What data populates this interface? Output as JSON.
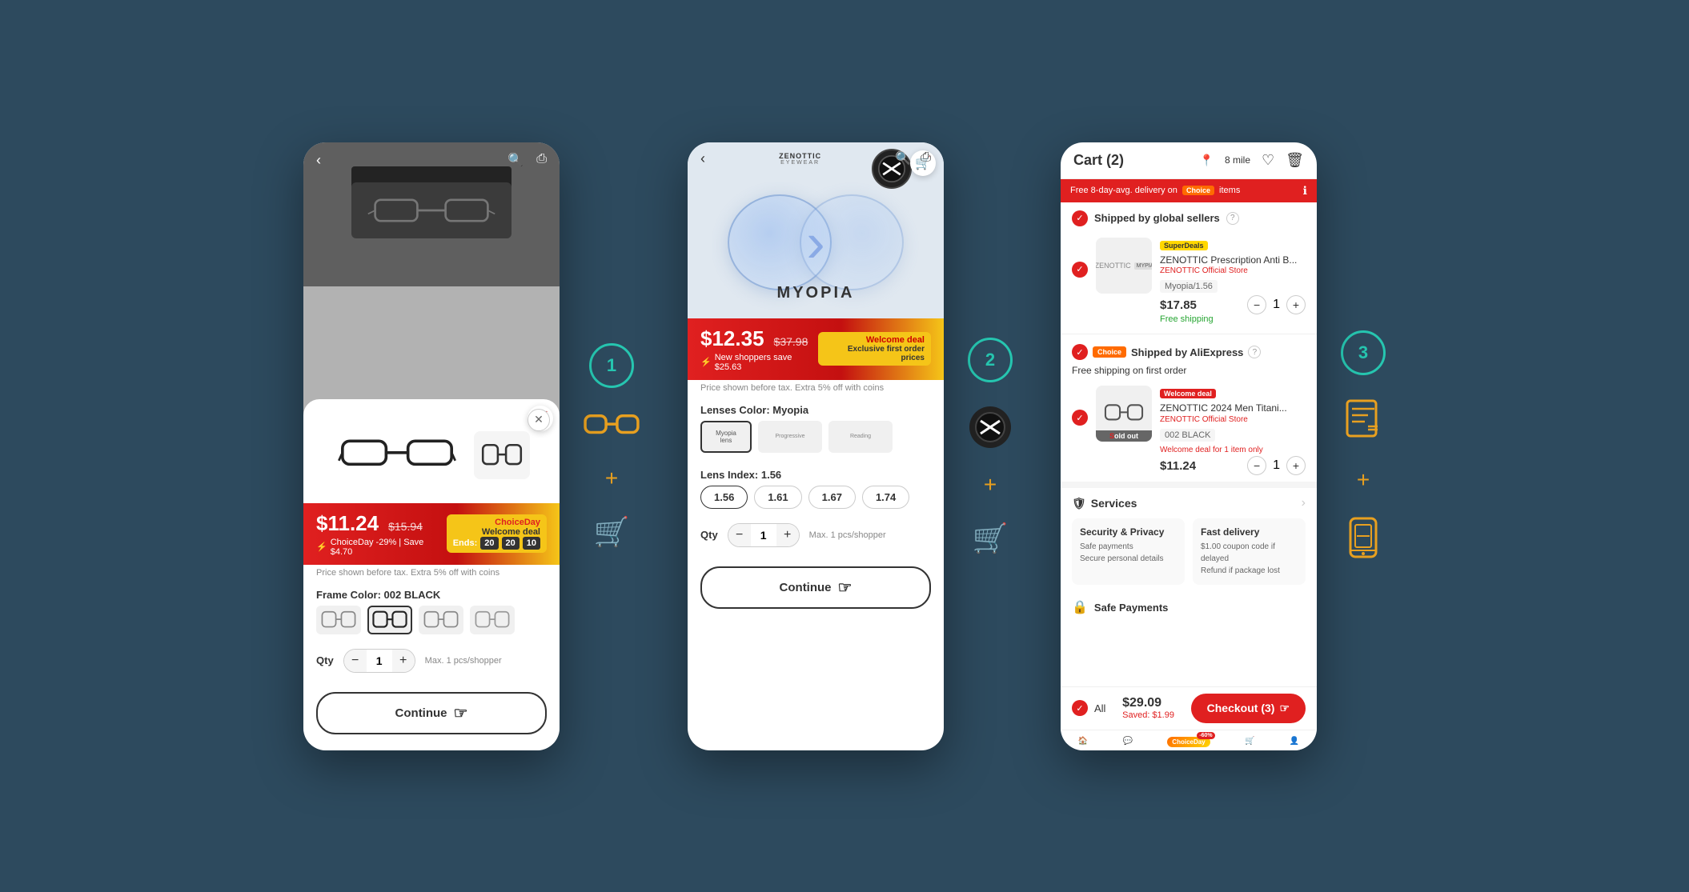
{
  "page": {
    "bg_color": "#2d4a5e"
  },
  "phone1": {
    "price_main": "$11.24",
    "price_orig": "$15.94",
    "badge_title": "ChoiceDay",
    "badge_sub": "Welcome deal",
    "discount_pct": "ChoiceDay -29% | Save $4.70",
    "ends_label": "Ends:",
    "countdown": [
      "20",
      "20",
      "10"
    ],
    "price_notice": "Price shown before tax. Extra 5% off with coins",
    "frame_color_label": "Frame Color: 002 BLACK",
    "qty_label": "Qty",
    "qty_value": "1",
    "max_note": "Max. 1 pcs/shopper",
    "continue_label": "Continue"
  },
  "phone2": {
    "brand": "ZENOTTIC",
    "brand_sub": "EYEWEAR",
    "lens_label": "MYOPIA",
    "price_main": "$12.35",
    "price_orig": "$37.98",
    "deal_label": "Welcome deal",
    "deal_sub": "Exclusive first order prices",
    "new_shopper_save": "New shoppers save $25.63",
    "price_notice": "Price shown before tax. Extra 5% off with coins",
    "lenses_color_label": "Lenses Color: Myopia",
    "lens_index_label": "Lens Index: 1.56",
    "index_options": [
      "1.56",
      "1.61",
      "1.67",
      "1.74"
    ],
    "qty_label": "Qty",
    "qty_value": "1",
    "max_note": "Max. 1 pcs/shopper",
    "continue_label": "Continue"
  },
  "phone3": {
    "cart_title": "Cart (2)",
    "location": "8 mile",
    "delivery_banner": "Free 8-day-avg. delivery on",
    "delivery_banner2": "items",
    "section1_title": "Shipped by global sellers",
    "item1_tag": "SuperDeals",
    "item1_name": "ZENOTTIC Prescription Anti B...",
    "item1_store": "ZENOTTIC Official Store",
    "item1_variant": "Myopia/1.56",
    "item1_price": "$17.85",
    "item1_qty": "1",
    "item1_shipping": "Free shipping",
    "section2_badge": "Choice",
    "section2_title": "Shipped by AliExpress",
    "free_ship_note": "Free shipping on first order",
    "item2_tag": "Welcome deal",
    "item2_name": "ZENOTTIC 2024 Men Titani...",
    "item2_store": "ZENOTTIC Official Store",
    "item2_variant": "002 BLACK",
    "item2_sold_out": "old out",
    "item2_welcome": "Welcome deal for 1 item only",
    "item2_price": "$11.24",
    "item2_qty": "1",
    "services_title": "Services",
    "service1_title": "Security & Privacy",
    "service1_desc1": "Safe payments",
    "service1_desc2": "Secure personal details",
    "service2_title": "Fast delivery",
    "service2_desc1": "$1.00 coupon code if delayed",
    "service2_desc2": "Refund if package lost",
    "safe_payments_title": "Safe Payments",
    "checkout_all": "All",
    "total": "$29.09",
    "saved": "Saved: $1.99",
    "checkout_label": "Checkout (3)",
    "nav_home": "🏠",
    "nav_chat": "💬",
    "nav_cart": "🛒",
    "nav_user": "👤",
    "choice_day_pct": "-60%",
    "choice_day_label": "ChoiceDay"
  },
  "steps": {
    "step1": "①",
    "step2": "②",
    "step3": "③"
  },
  "icons": {
    "glasses": "👓",
    "plus": "+",
    "cart": "🛒",
    "invoice": "📋",
    "phone_scan": "📱"
  }
}
